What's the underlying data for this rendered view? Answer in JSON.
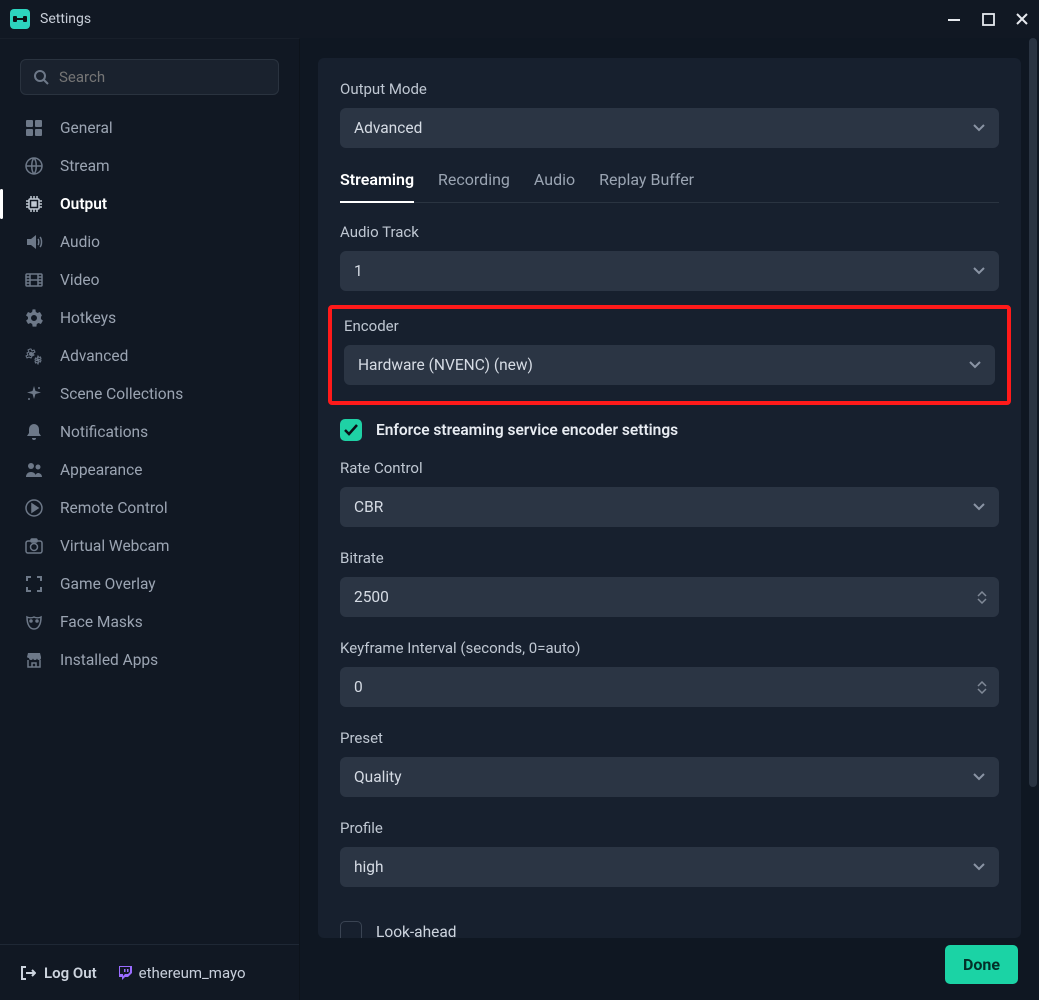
{
  "window": {
    "title": "Settings"
  },
  "search": {
    "placeholder": "Search"
  },
  "sidebar": {
    "items": [
      {
        "label": "General",
        "icon": "grid-icon"
      },
      {
        "label": "Stream",
        "icon": "globe-icon"
      },
      {
        "label": "Output",
        "icon": "chip-icon",
        "active": true
      },
      {
        "label": "Audio",
        "icon": "volume-icon"
      },
      {
        "label": "Video",
        "icon": "film-icon"
      },
      {
        "label": "Hotkeys",
        "icon": "gear-icon"
      },
      {
        "label": "Advanced",
        "icon": "gears-icon"
      },
      {
        "label": "Scene Collections",
        "icon": "sparkle-icon"
      },
      {
        "label": "Notifications",
        "icon": "bell-icon"
      },
      {
        "label": "Appearance",
        "icon": "people-icon"
      },
      {
        "label": "Remote Control",
        "icon": "play-circle-icon"
      },
      {
        "label": "Virtual Webcam",
        "icon": "camera-icon"
      },
      {
        "label": "Game Overlay",
        "icon": "expand-icon"
      },
      {
        "label": "Face Masks",
        "icon": "mask-icon"
      },
      {
        "label": "Installed Apps",
        "icon": "store-icon"
      }
    ]
  },
  "footer": {
    "logout": "Log Out",
    "user": "ethereum_mayo"
  },
  "output": {
    "mode_label": "Output Mode",
    "mode_value": "Advanced",
    "tabs": [
      "Streaming",
      "Recording",
      "Audio",
      "Replay Buffer"
    ],
    "active_tab": "Streaming",
    "audio_track_label": "Audio Track",
    "audio_track_value": "1",
    "encoder_label": "Encoder",
    "encoder_value": "Hardware (NVENC) (new)",
    "enforce_label": "Enforce streaming service encoder settings",
    "enforce_checked": true,
    "rate_label": "Rate Control",
    "rate_value": "CBR",
    "bitrate_label": "Bitrate",
    "bitrate_value": "2500",
    "keyframe_label": "Keyframe Interval (seconds, 0=auto)",
    "keyframe_value": "0",
    "preset_label": "Preset",
    "preset_value": "Quality",
    "profile_label": "Profile",
    "profile_value": "high",
    "lookahead_label": "Look-ahead",
    "lookahead_checked": false
  },
  "actions": {
    "done": "Done"
  }
}
